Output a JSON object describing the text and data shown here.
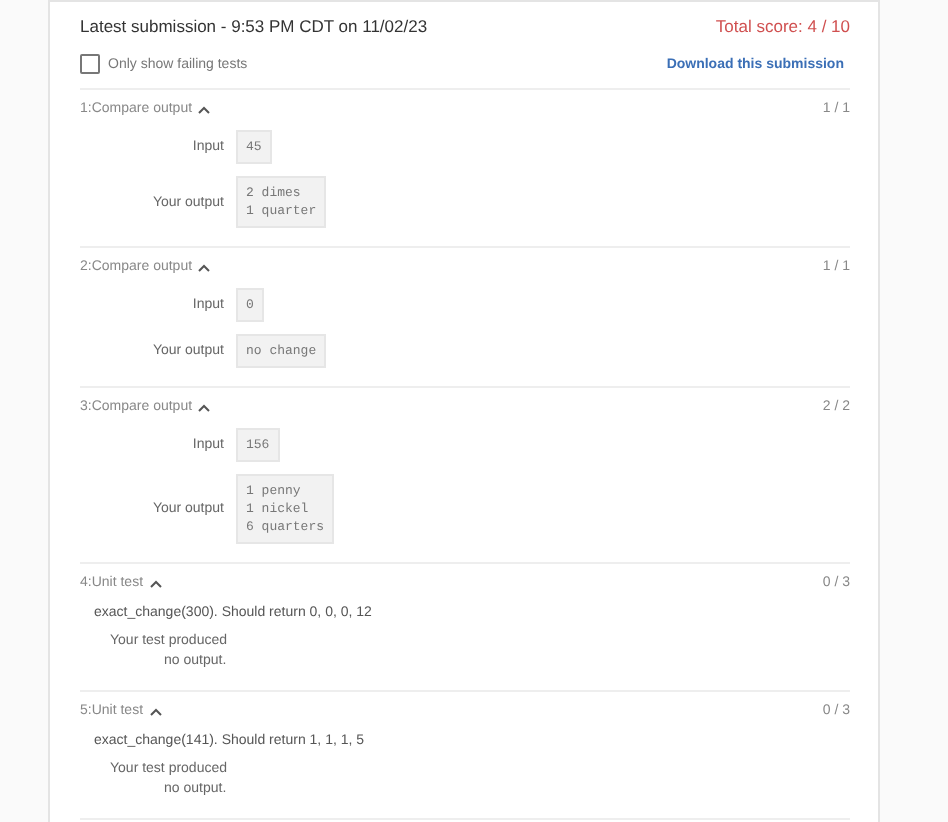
{
  "header": {
    "title": "Latest submission - 9:53 PM CDT on 11/02/23",
    "score": "Total score: 4 / 10"
  },
  "filter": {
    "label": "Only show failing tests",
    "checked": false
  },
  "download": "Download this submission",
  "tests": [
    {
      "kind": "compare",
      "title": "1:Compare output",
      "expanded": true,
      "score": "1 / 1",
      "input_label": "Input",
      "input": "45",
      "output_label": "Your output",
      "output": [
        "2 dimes",
        "1 quarter"
      ]
    },
    {
      "kind": "compare",
      "title": "2:Compare output",
      "expanded": true,
      "score": "1 / 1",
      "input_label": "Input",
      "input": "0",
      "output_label": "Your output",
      "output": [
        "no change"
      ]
    },
    {
      "kind": "compare",
      "title": "3:Compare output",
      "expanded": true,
      "score": "2 / 2",
      "input_label": "Input",
      "input": "156",
      "output_label": "Your output",
      "output": [
        "1 penny",
        "1 nickel",
        "6 quarters"
      ]
    },
    {
      "kind": "unit",
      "title": "4:Unit test",
      "expanded": true,
      "score": "0 / 3",
      "description": "exact_change(300). Should return 0, 0, 0, 12",
      "result": [
        "Your test produced",
        "no output."
      ]
    },
    {
      "kind": "unit",
      "title": "5:Unit test",
      "expanded": true,
      "score": "0 / 3",
      "description": "exact_change(141). Should return 1, 1, 1, 5",
      "result": [
        "Your test produced",
        "no output."
      ]
    }
  ]
}
